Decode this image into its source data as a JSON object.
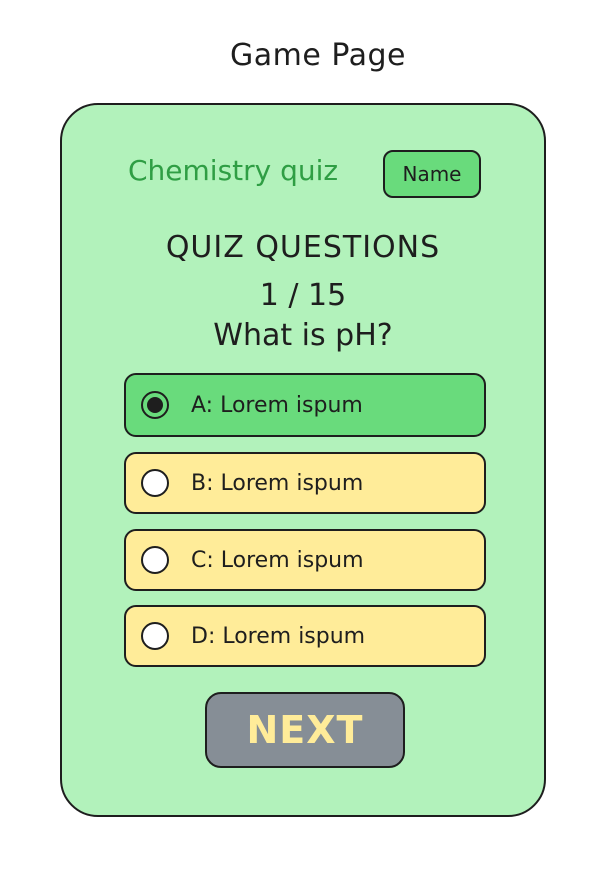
{
  "page": {
    "title": "Game Page"
  },
  "quiz": {
    "name": "Chemistry quiz",
    "name_button": "Name",
    "heading": "QUIZ QUESTIONS",
    "progress": "1 / 15",
    "question": "What is pH?"
  },
  "options": [
    {
      "label": "A: Lorem ispum",
      "selected": true
    },
    {
      "label": "B: Lorem ispum",
      "selected": false
    },
    {
      "label": "C: Lorem ispum",
      "selected": false
    },
    {
      "label": "D: Lorem ispum",
      "selected": false
    }
  ],
  "next_button": {
    "label": "NEXT"
  },
  "colors": {
    "card_bg": "#b2f2bb",
    "selected_option": "#69db7c",
    "unselected_option": "#ffec99",
    "quiz_name": "#2f9e44",
    "next_button_bg": "#868e96",
    "next_button_text": "#ffec99"
  }
}
